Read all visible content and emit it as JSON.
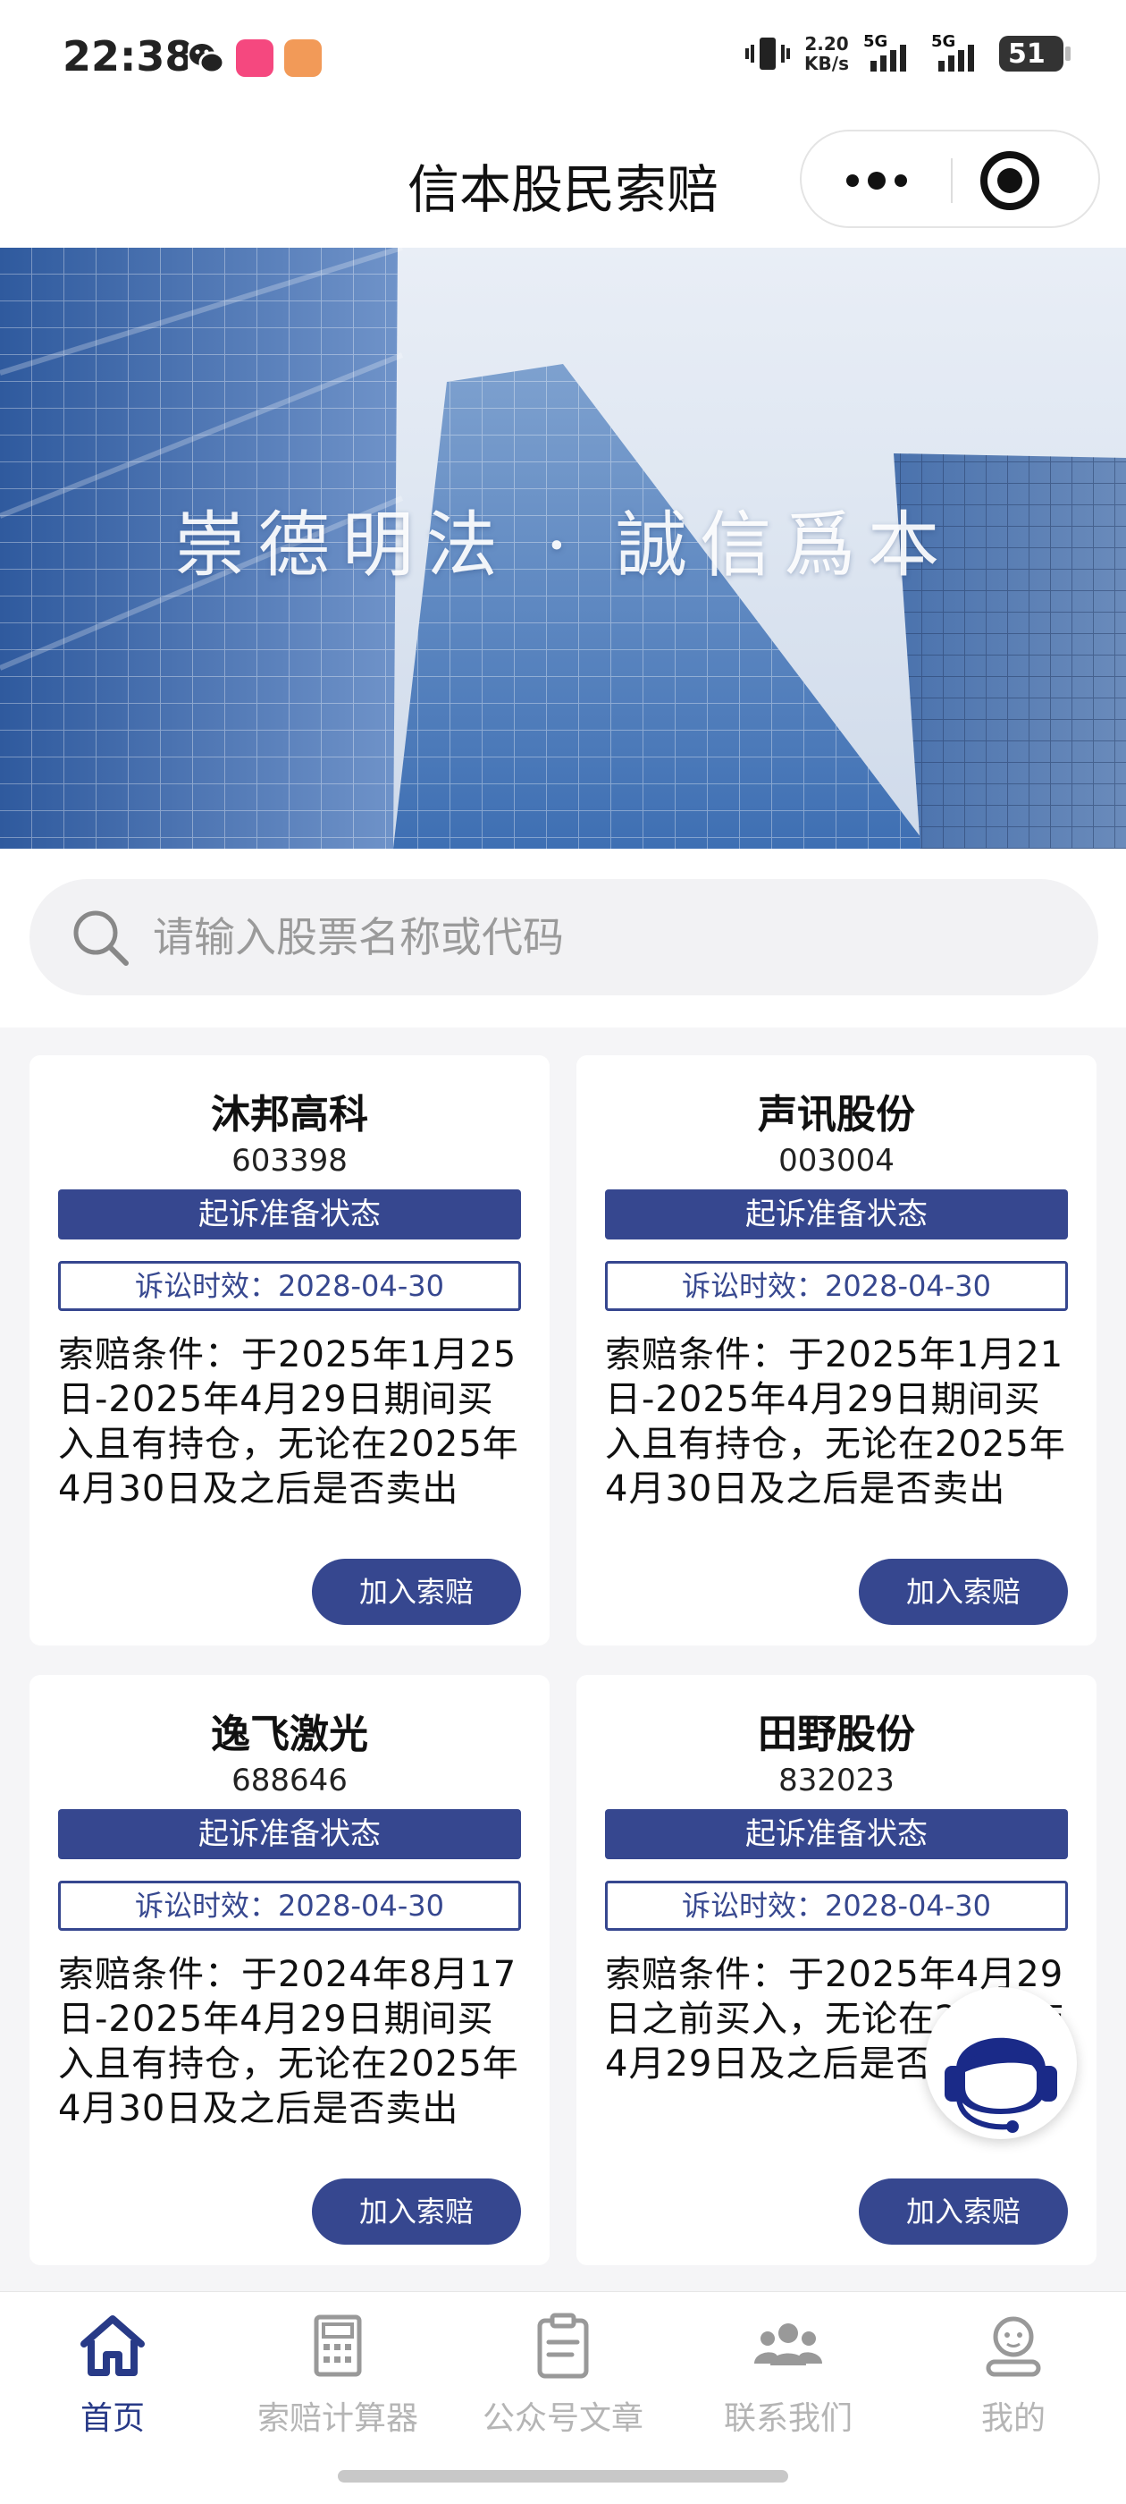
{
  "status_bar": {
    "time": "22:38",
    "net_speed": "2.20",
    "net_unit": "KB/s",
    "sim1": "5G",
    "sim2": "5G",
    "battery": "51"
  },
  "header": {
    "title": "信本股民索赔"
  },
  "banner": {
    "slogan": "崇德明法 · 誠信爲本"
  },
  "search": {
    "placeholder": "请输入股票名称或代码",
    "value": ""
  },
  "cards": [
    {
      "name": "沐邦高科",
      "code": "603398",
      "status": "起诉准备状态",
      "limitation": "诉讼时效：2028-04-30",
      "condition": "索赔条件：于2025年1月25日-2025年4月29日期间买入且有持仓，无论在2025年4月30日及之后是否卖出",
      "button": "加入索赔"
    },
    {
      "name": "声讯股份",
      "code": "003004",
      "status": "起诉准备状态",
      "limitation": "诉讼时效：2028-04-30",
      "condition": "索赔条件：于2025年1月21日-2025年4月29日期间买入且有持仓，无论在2025年4月30日及之后是否卖出",
      "button": "加入索赔"
    },
    {
      "name": "逸飞激光",
      "code": "688646",
      "status": "起诉准备状态",
      "limitation": "诉讼时效：2028-04-30",
      "condition": "索赔条件：于2024年8月17日-2025年4月29日期间买入且有持仓，无论在2025年4月30日及之后是否卖出",
      "button": "加入索赔"
    },
    {
      "name": "田野股份",
      "code": "832023",
      "status": "起诉准备状态",
      "limitation": "诉讼时效：2028-04-30",
      "condition": "索赔条件：于2025年4月29日之前买入，无论在2025年4月29日及之后是否卖出",
      "button": "加入索赔"
    }
  ],
  "tabs": [
    {
      "label": "首页",
      "icon": "home-icon",
      "active": true
    },
    {
      "label": "索赔计算器",
      "icon": "calculator-icon",
      "active": false
    },
    {
      "label": "公众号文章",
      "icon": "clipboard-icon",
      "active": false
    },
    {
      "label": "联系我们",
      "icon": "people-icon",
      "active": false
    },
    {
      "label": "我的",
      "icon": "user-icon",
      "active": false
    }
  ],
  "colors": {
    "accent": "#36478f",
    "tab_active": "#283a87",
    "tab_inactive": "#b5b5b5"
  },
  "floating_button": {
    "icon": "customer-service-icon"
  }
}
